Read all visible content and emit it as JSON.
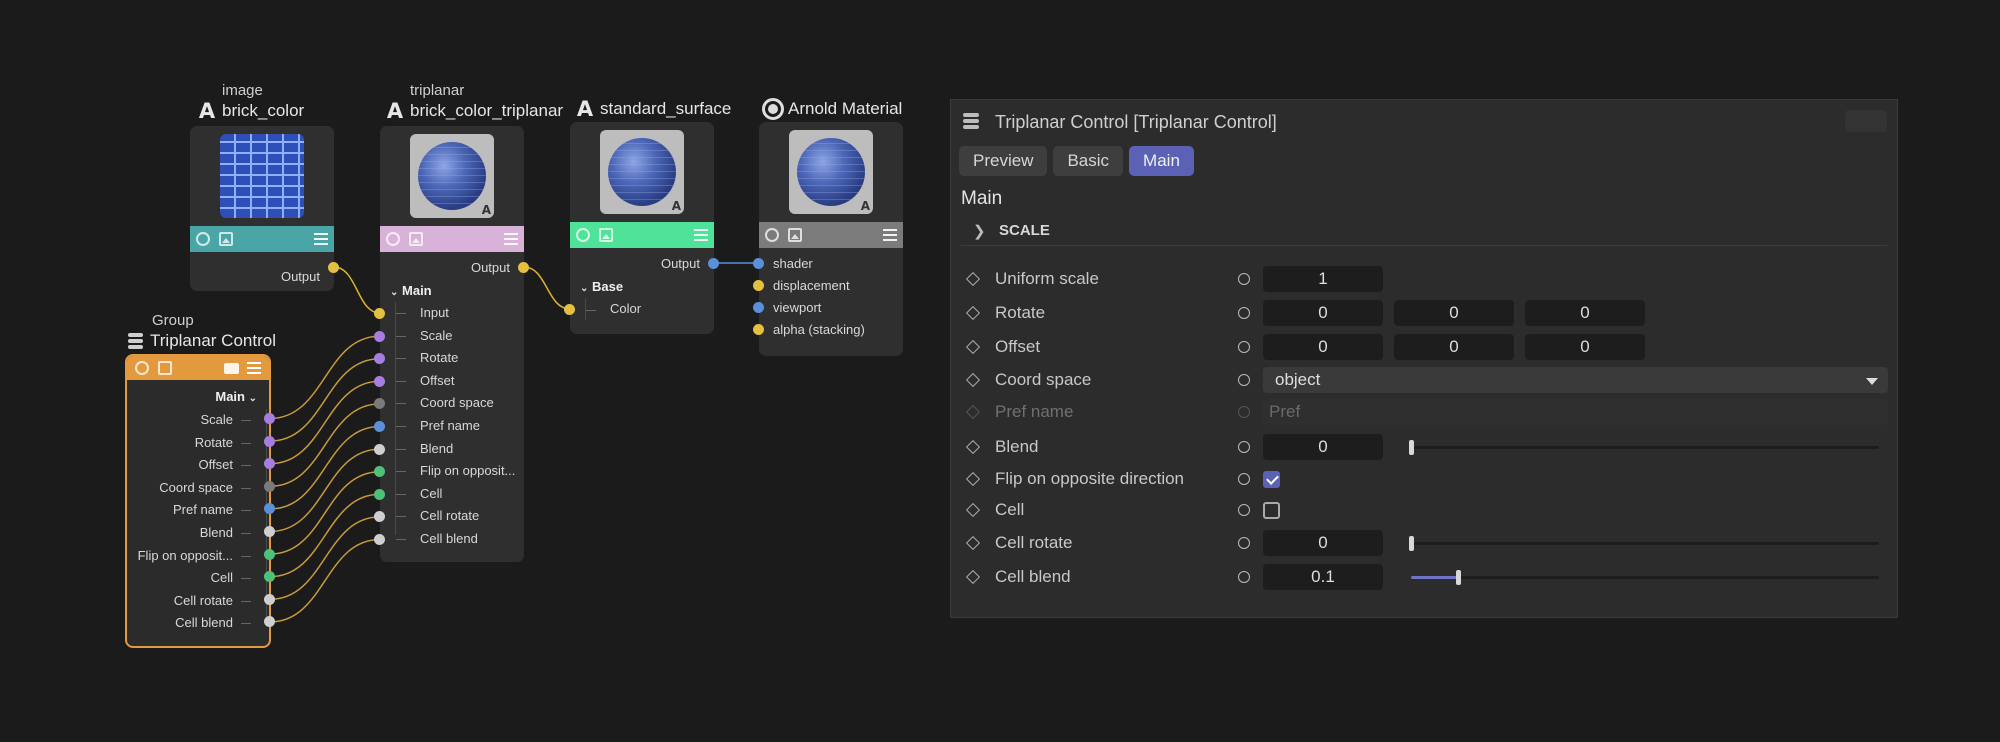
{
  "nodes": {
    "image": {
      "type": "image",
      "name": "brick_color",
      "output": "Output"
    },
    "triplanar": {
      "type": "triplanar",
      "name": "brick_color_triplanar",
      "output": "Output",
      "section": "Main",
      "inputs": [
        "Input",
        "Scale",
        "Rotate",
        "Offset",
        "Coord space",
        "Pref name",
        "Blend",
        "Flip on opposit...",
        "Cell",
        "Cell rotate",
        "Cell blend"
      ]
    },
    "standard_surface": {
      "name": "standard_surface",
      "output": "Output",
      "section": "Base",
      "inputs": [
        "Color"
      ]
    },
    "arnold": {
      "name": "Arnold Material",
      "inputs": [
        "shader",
        "displacement",
        "viewport",
        "alpha (stacking)"
      ]
    },
    "group": {
      "type": "Group",
      "name": "Triplanar Control",
      "section": "Main",
      "outputs": [
        "Scale",
        "Rotate",
        "Offset",
        "Coord space",
        "Pref name",
        "Blend",
        "Flip on opposit...",
        "Cell",
        "Cell rotate",
        "Cell blend"
      ]
    }
  },
  "colors": {
    "image_bar": "#4aa6a6",
    "triplanar_bar": "#d9b2d9",
    "surface_bar": "#4fe39a",
    "arnold_bar": "#7b7b7b",
    "group": "#e39a3e",
    "accent": "#5b61b5"
  },
  "panel": {
    "title": "Triplanar Control [Triplanar Control]",
    "tabs": [
      "Preview",
      "Basic",
      "Main"
    ],
    "active_tab": "Main",
    "section": "Main",
    "collapsed_group": "SCALE",
    "params": {
      "uniform_scale": {
        "label": "Uniform scale",
        "value": "1"
      },
      "rotate": {
        "label": "Rotate",
        "x": "0",
        "y": "0",
        "z": "0"
      },
      "offset": {
        "label": "Offset",
        "x": "0",
        "y": "0",
        "z": "0"
      },
      "coord_space": {
        "label": "Coord space",
        "value": "object"
      },
      "pref_name": {
        "label": "Pref name",
        "placeholder": "Pref"
      },
      "blend": {
        "label": "Blend",
        "value": "0",
        "fraction": 0
      },
      "flip": {
        "label": "Flip on opposite direction",
        "checked": true
      },
      "cell": {
        "label": "Cell",
        "checked": false
      },
      "cell_rotate": {
        "label": "Cell rotate",
        "value": "0",
        "fraction": 0
      },
      "cell_blend": {
        "label": "Cell blend",
        "value": "0.1",
        "fraction": 0.1
      }
    }
  }
}
